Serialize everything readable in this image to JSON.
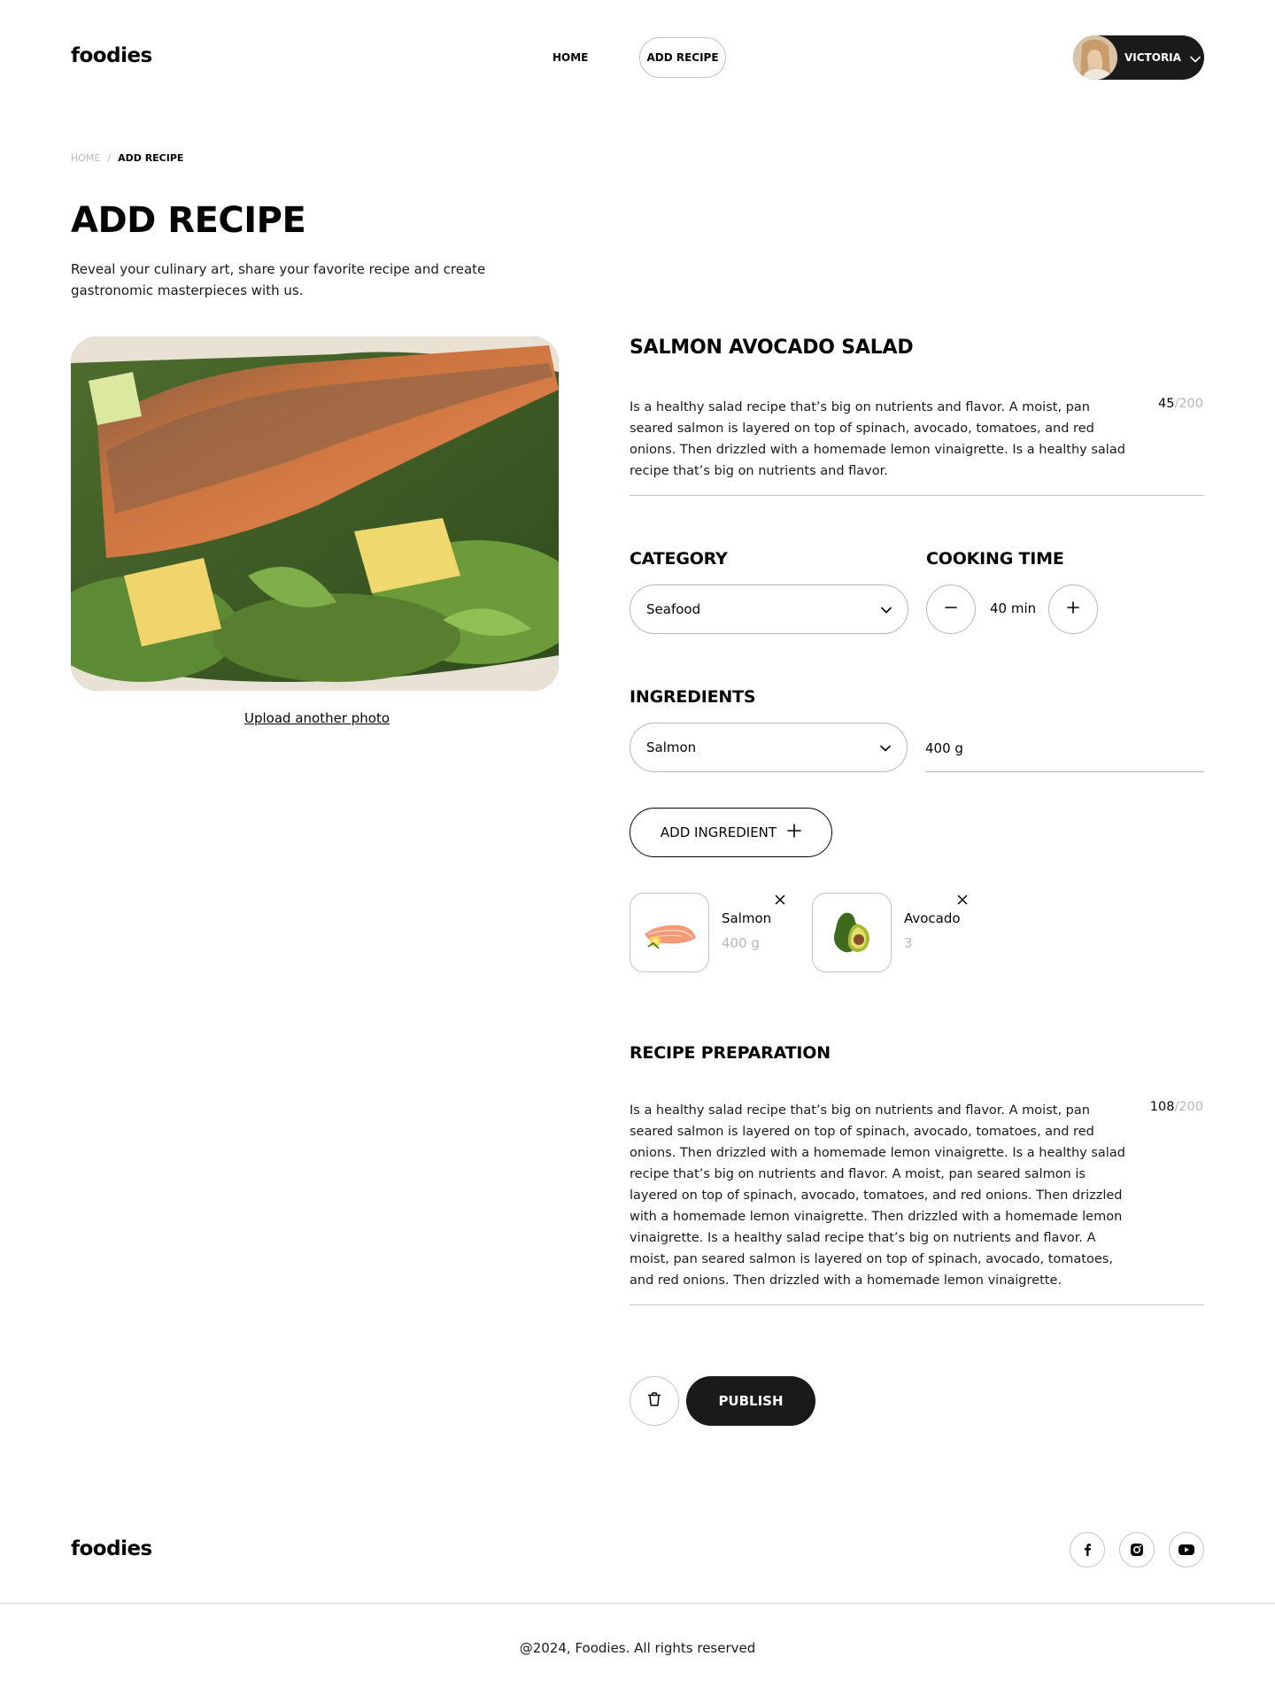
{
  "brand": {
    "logo": "foodies"
  },
  "nav": {
    "home": "HOME",
    "add_recipe": "ADD RECIPE"
  },
  "user": {
    "name": "VICTORIA"
  },
  "breadcrumb": {
    "home": "HOME",
    "separator": "/",
    "current": "ADD RECIPE"
  },
  "page": {
    "title": "ADD RECIPE",
    "subtitle": "Reveal your culinary art, share your favorite recipe and create gastronomic masterpieces with us."
  },
  "photo": {
    "upload_link": "Upload another photo"
  },
  "recipe": {
    "title": "SALMON AVOCADO SALAD",
    "description": "Is a healthy salad recipe that’s big on nutrients and flavor. A moist, pan seared salmon is layered on top of spinach, avocado, tomatoes, and red onions. Then drizzled with a homemade lemon vinaigrette. Is a healthy salad recipe that’s big on nutrients and flavor.",
    "description_count": "45",
    "description_max": "/200"
  },
  "category": {
    "label": "CATEGORY",
    "value": "Seafood"
  },
  "cooking_time": {
    "label": "COOKING TIME",
    "value": "40 min"
  },
  "ingredients": {
    "label": "INGREDIENTS",
    "selected": "Salmon",
    "quantity": "400 g",
    "add_button": "ADD INGREDIENT",
    "items": [
      {
        "name": "Salmon",
        "qty": "400 g"
      },
      {
        "name": "Avocado",
        "qty": "3"
      }
    ]
  },
  "preparation": {
    "label": "RECIPE PREPARATION",
    "text": "Is a healthy salad recipe that’s big on nutrients and flavor. A moist, pan seared salmon is layered on top of spinach, avocado, tomatoes, and red onions. Then drizzled with a homemade lemon vinaigrette. Is a healthy salad recipe that’s big on nutrients and flavor. A moist, pan seared salmon is layered on top of spinach, avocado, tomatoes, and red onions. Then drizzled with a homemade lemon vinaigrette. Then drizzled with a homemade lemon vinaigrette. Is a healthy salad recipe that’s big on nutrients and flavor. A moist, pan seared salmon is layered on top of spinach, avocado, tomatoes, and red onions. Then drizzled with a homemade lemon vinaigrette.",
    "count": "108",
    "max": "/200"
  },
  "actions": {
    "publish": "PUBLISH"
  },
  "footer": {
    "logo": "foodies",
    "copyright": "@2024, Foodies. All rights reserved",
    "social": [
      "facebook-icon",
      "instagram-icon",
      "youtube-icon"
    ]
  },
  "colors": {
    "dark": "#1a1a1a",
    "muted": "#b8b8b8",
    "border": "#c4c4c4"
  }
}
